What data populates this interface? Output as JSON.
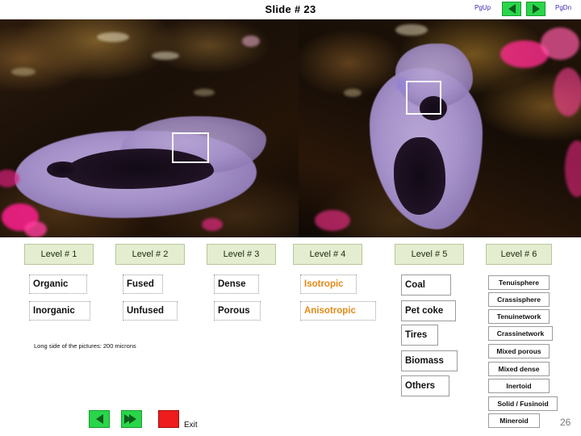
{
  "header": {
    "slide_title": "Slide  # 23",
    "pgup_label": "PgUp",
    "pgdn_label": "PgDn",
    "nav_prev_icon": "triangle-left-icon",
    "nav_next_icon": "triangle-right-icon"
  },
  "images": {
    "left_alt": "coal-petrography-micrograph-left",
    "right_alt": "coal-petrography-micrograph-right",
    "selection_box_icon": "selection-rectangle"
  },
  "levels": [
    {
      "label": "Level # 1"
    },
    {
      "label": "Level # 2"
    },
    {
      "label": "Level # 3"
    },
    {
      "label": "Level # 4"
    },
    {
      "label": "Level # 5"
    },
    {
      "label": "Level # 6"
    }
  ],
  "columns": {
    "level1": [
      "Organic",
      "Inorganic"
    ],
    "level2": [
      "Fused",
      "Unfused"
    ],
    "level3": [
      "Dense",
      "Porous"
    ],
    "level4": [
      "Isotropic",
      "Anisotropic"
    ],
    "level5": [
      "Coal",
      "Pet coke",
      "Tires",
      "Biomass",
      "Others"
    ],
    "level6": [
      "Tenuisphere",
      "Crassisphere",
      "Tenuinetwork",
      "Crassinetwork",
      "Mixed porous",
      "Mixed dense",
      "Inertoid",
      "Solid / Fusinoid",
      "Mineroid"
    ]
  },
  "caption": "Long side of the pictures: 200 microns",
  "footer": {
    "back_icon": "triangle-left-icon",
    "forward_icon": "double-triangle-right-icon",
    "stop_icon": "stop-square-icon",
    "exit_label": "Exit",
    "page_number": "26"
  },
  "colors": {
    "nav_green": "#2ad54a",
    "stop_red": "#ee1c1c",
    "level_header_bg": "#e4edd0",
    "orange_text": "#e28a18",
    "pg_label": "#3b2bb5"
  }
}
